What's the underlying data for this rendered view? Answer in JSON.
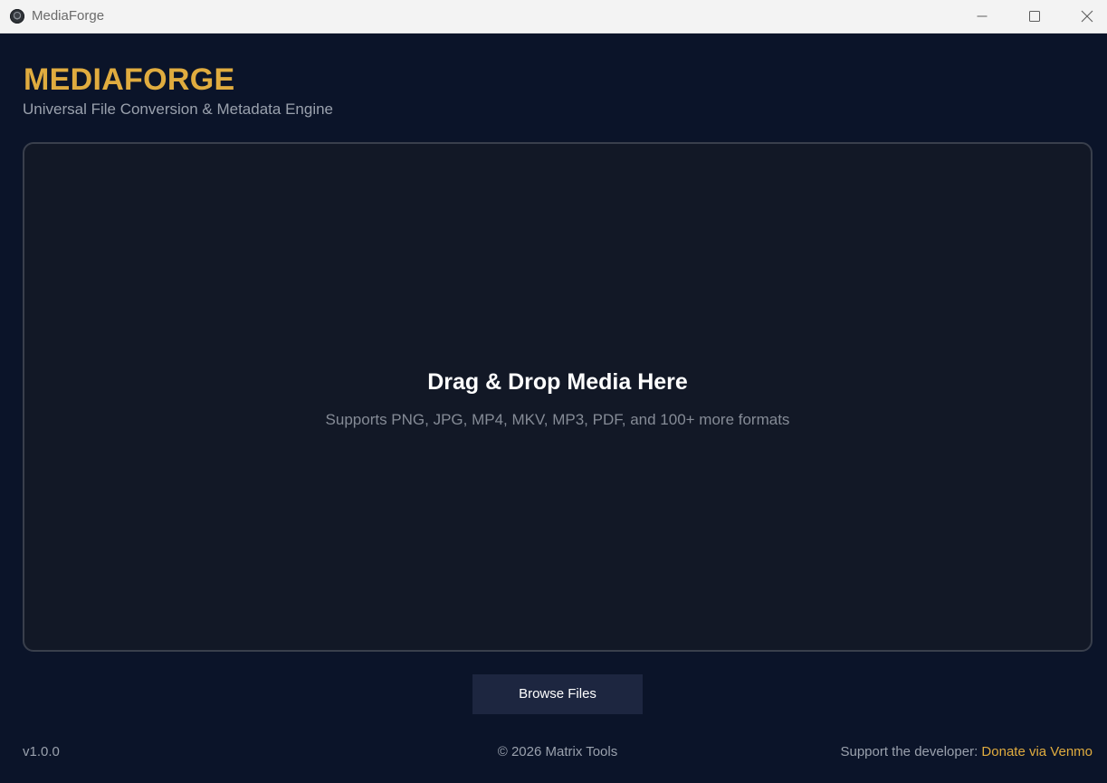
{
  "window": {
    "title": "MediaForge",
    "controls": {
      "minimize": "minimize-icon",
      "maximize": "maximize-icon",
      "close": "close-icon"
    }
  },
  "header": {
    "brand": "MEDIAFORGE",
    "subtitle": "Universal File Conversion & Metadata Engine"
  },
  "dropzone": {
    "title": "Drag & Drop Media Here",
    "subtitle": "Supports PNG, JPG, MP4, MKV, MP3, PDF, and 100+ more formats"
  },
  "actions": {
    "browse_label": "Browse Files"
  },
  "footer": {
    "version": "v1.0.0",
    "copyright": "© 2026 Matrix Tools",
    "support_label": "Support the developer:",
    "donate_label": "Donate via Venmo"
  },
  "colors": {
    "background": "#0b1429",
    "accent": "#e0ac3f",
    "dropzone_bg": "#121826",
    "dropzone_border": "#393f4c",
    "button_bg": "#1d2640"
  }
}
